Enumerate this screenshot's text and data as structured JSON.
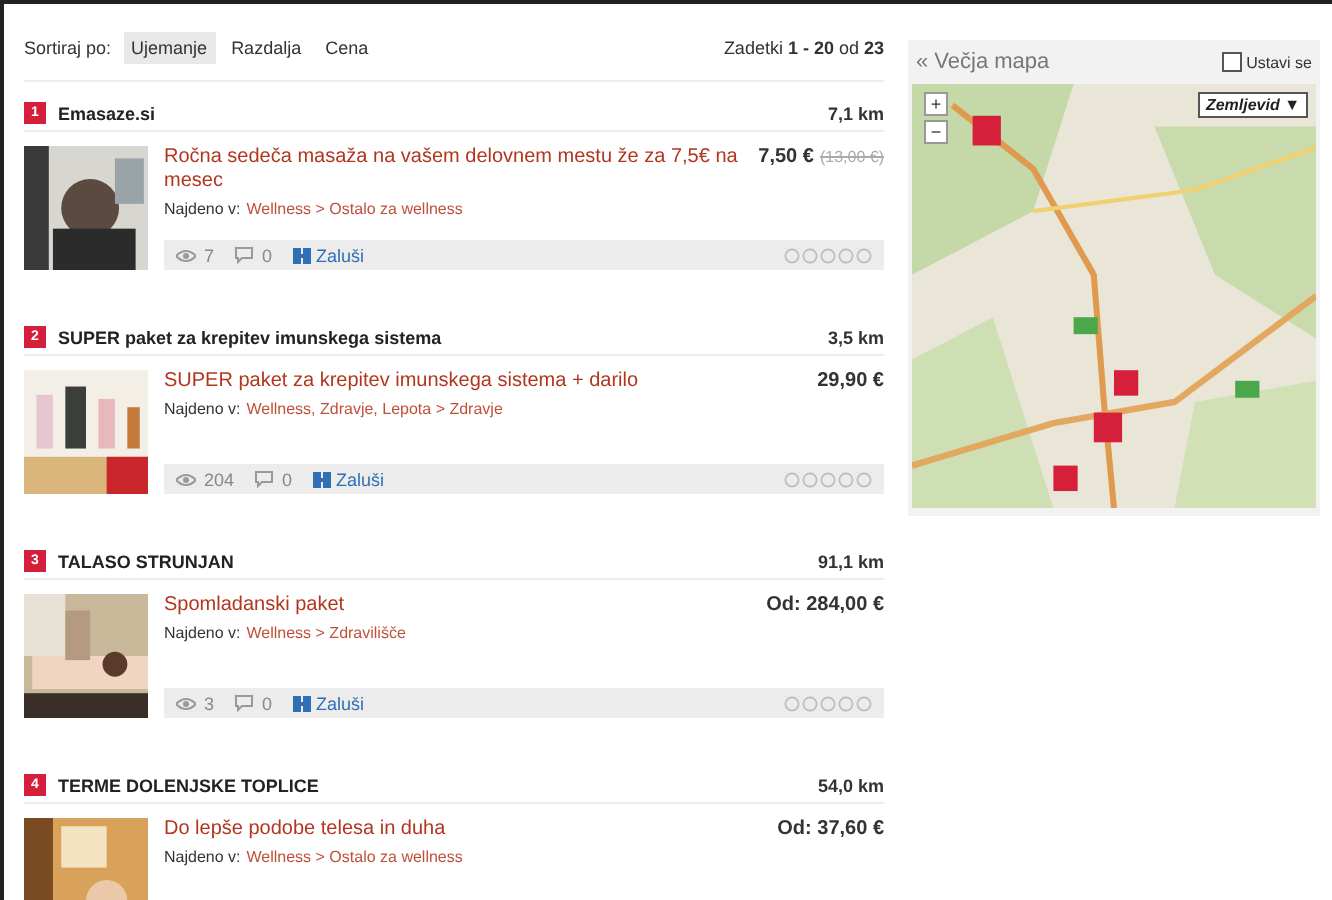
{
  "sort": {
    "label": "Sortiraj po:",
    "options": [
      {
        "label": "Ujemanje",
        "selected": true
      },
      {
        "label": "Razdalja",
        "selected": false
      },
      {
        "label": "Cena",
        "selected": false
      }
    ]
  },
  "results": "Zadetki **1 - 20** od **23**",
  "items": [
    {
      "number": "1",
      "title": "Emasaze.si",
      "distance": "7,1 km",
      "offer": "Ročna sedeča masaža na vašem delovnem mestu že za 7,5€ na mesec",
      "price": "7,50 €",
      "old_price": "(13,00 €)",
      "found_label": "Najdeno v:",
      "path": "Wellness > Ostalo za wellness",
      "stats": {
        "views": "7",
        "comments": "0",
        "save": "Zaluši"
      },
      "stars": 0
    },
    {
      "number": "2",
      "title": "SUPER paket za krepitev imunskega sistema",
      "distance": "3,5 km",
      "offer": "SUPER paket za krepitev imunskega sistema + darilo",
      "price": "29,90 €",
      "found_label": "Najdeno v:",
      "path": "Wellness, Zdravje, Lepota > Zdravje",
      "stats": {
        "views": "204",
        "comments": "0",
        "save": "Zaluši"
      },
      "stars": 0
    },
    {
      "number": "3",
      "title": "TALASO STRUNJAN",
      "distance": "91,1 km",
      "offer": "Spomladanski paket",
      "price": "Od: 284,00 €",
      "found_label": "Najdeno v:",
      "path": "Wellness > Zdravilišče",
      "stats": {
        "views": "3",
        "comments": "0",
        "save": "Zaluši"
      },
      "stars": 0
    },
    {
      "number": "4",
      "title": "TERME DOLENJSKE TOPLICE",
      "distance": "54,0 km",
      "offer": "Do lepše podobe telesa in duha",
      "price": "Od: 37,60 €",
      "found_label": "Najdeno v:",
      "path": "Wellness > Ostalo za wellness"
    }
  ],
  "map": {
    "link": "« Večja mapa",
    "stop": {
      "label": "Ustavi se",
      "checked": false
    },
    "zoom_in": "+",
    "zoom_out": "−",
    "type": "Zemljevid ▼"
  }
}
